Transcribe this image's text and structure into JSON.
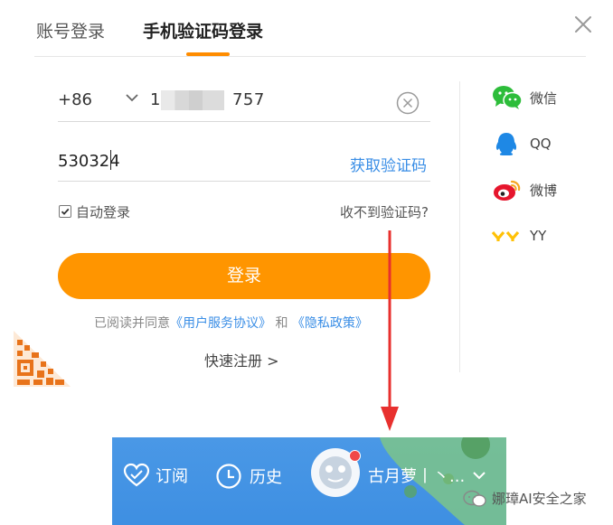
{
  "tabs": {
    "account_login": "账号登录",
    "sms_login": "手机验证码登录"
  },
  "phone": {
    "country_code": "+86",
    "number_prefix": "1",
    "number_suffix": "757"
  },
  "code": {
    "value": "530324",
    "get_code_label": "获取验证码"
  },
  "remember": {
    "label": "自动登录",
    "checked": true,
    "no_code_label": "收不到验证码?"
  },
  "login_button": "登录",
  "agreement": {
    "prefix": "已阅读并同意",
    "user_agreement": "《用户服务协议》",
    "and": "和",
    "privacy": "《隐私政策》"
  },
  "quick_register": "快速注册 >",
  "social": [
    {
      "label": "微信",
      "icon": "wechat-icon",
      "color": "#2dbd3a"
    },
    {
      "label": "QQ",
      "icon": "qq-icon",
      "color": "#1e88e5"
    },
    {
      "label": "微博",
      "icon": "weibo-icon",
      "color": "#e6162d"
    },
    {
      "label": "YY",
      "icon": "yy-icon",
      "color": "#ffc107"
    }
  ],
  "bottom_bar": {
    "subscribe": "订阅",
    "history": "历史",
    "channel": "古月萝丨丶..."
  },
  "watermark": "娜璋AI安全之家",
  "colors": {
    "accent": "#ff9500",
    "link": "#3a8ee6",
    "bar_blue": "#3e8fe2"
  }
}
